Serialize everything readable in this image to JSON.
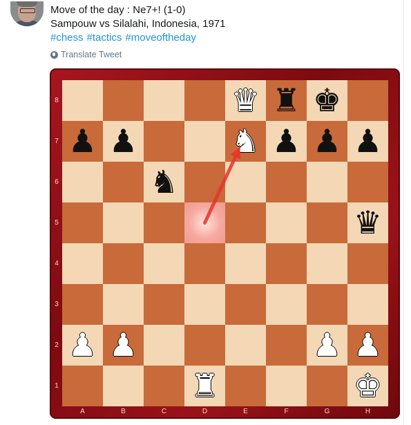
{
  "tweet": {
    "line1": "Move of the day : Ne7+! (1-0)",
    "line2": "Sampouw vs Silalahi, Indonesia, 1971",
    "hashtags": [
      "#chess",
      "#tactics",
      "#moveoftheday"
    ],
    "translate_label": "Translate Tweet"
  },
  "board": {
    "files": [
      "A",
      "B",
      "C",
      "D",
      "E",
      "F",
      "G",
      "H"
    ],
    "ranks": [
      "8",
      "7",
      "6",
      "5",
      "4",
      "3",
      "2",
      "1"
    ],
    "highlight_square": "d5",
    "arrow": {
      "from": "d5",
      "to": "e7",
      "color": "#e8332a"
    },
    "pieces": [
      {
        "square": "e8",
        "color": "w",
        "type": "queen",
        "glyph": "♛"
      },
      {
        "square": "f8",
        "color": "b",
        "type": "rook",
        "glyph": "♜"
      },
      {
        "square": "g8",
        "color": "b",
        "type": "king",
        "glyph": "♚"
      },
      {
        "square": "a7",
        "color": "b",
        "type": "pawn",
        "glyph": "♟"
      },
      {
        "square": "b7",
        "color": "b",
        "type": "pawn",
        "glyph": "♟"
      },
      {
        "square": "e7",
        "color": "w",
        "type": "knight",
        "glyph": "♞"
      },
      {
        "square": "f7",
        "color": "b",
        "type": "pawn",
        "glyph": "♟"
      },
      {
        "square": "g7",
        "color": "b",
        "type": "pawn",
        "glyph": "♟"
      },
      {
        "square": "h7",
        "color": "b",
        "type": "pawn",
        "glyph": "♟"
      },
      {
        "square": "c6",
        "color": "b",
        "type": "knight",
        "glyph": "♞"
      },
      {
        "square": "h5",
        "color": "b",
        "type": "queen",
        "glyph": "♛"
      },
      {
        "square": "a2",
        "color": "w",
        "type": "pawn",
        "glyph": "♟"
      },
      {
        "square": "b2",
        "color": "w",
        "type": "pawn",
        "glyph": "♟"
      },
      {
        "square": "g2",
        "color": "w",
        "type": "pawn",
        "glyph": "♟"
      },
      {
        "square": "h2",
        "color": "w",
        "type": "pawn",
        "glyph": "♟"
      },
      {
        "square": "d1",
        "color": "w",
        "type": "rook",
        "glyph": "♜"
      },
      {
        "square": "h1",
        "color": "w",
        "type": "king",
        "glyph": "♚"
      }
    ]
  }
}
